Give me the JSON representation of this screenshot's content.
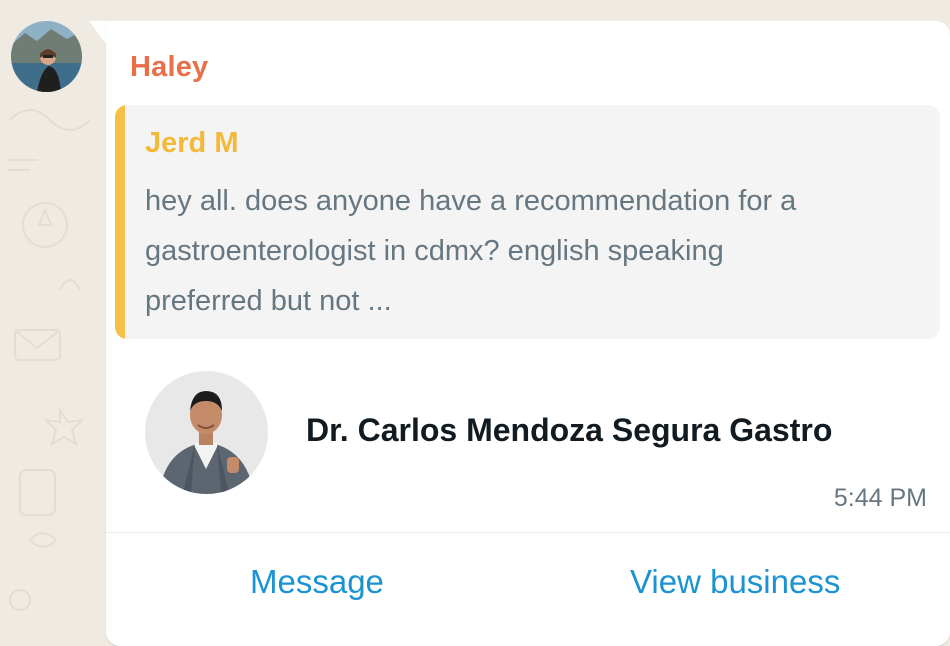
{
  "message": {
    "sender_name": "Haley",
    "quoted": {
      "author": "Jerd M",
      "text": "hey all. does anyone have a recommendation for a gastroenterologist in cdmx? english speaking preferred but not ..."
    },
    "contact_card": {
      "name": "Dr. Carlos Mendoza Segura Gastro"
    },
    "time": "5:44 PM",
    "actions": {
      "message_label": "Message",
      "view_business_label": "View business"
    }
  },
  "colors": {
    "sender_name": "#e7704a",
    "quote_author": "#f5b93a",
    "quote_bar": "#f7c147",
    "action_link": "#1b93d3",
    "chat_background": "#efeae2"
  }
}
